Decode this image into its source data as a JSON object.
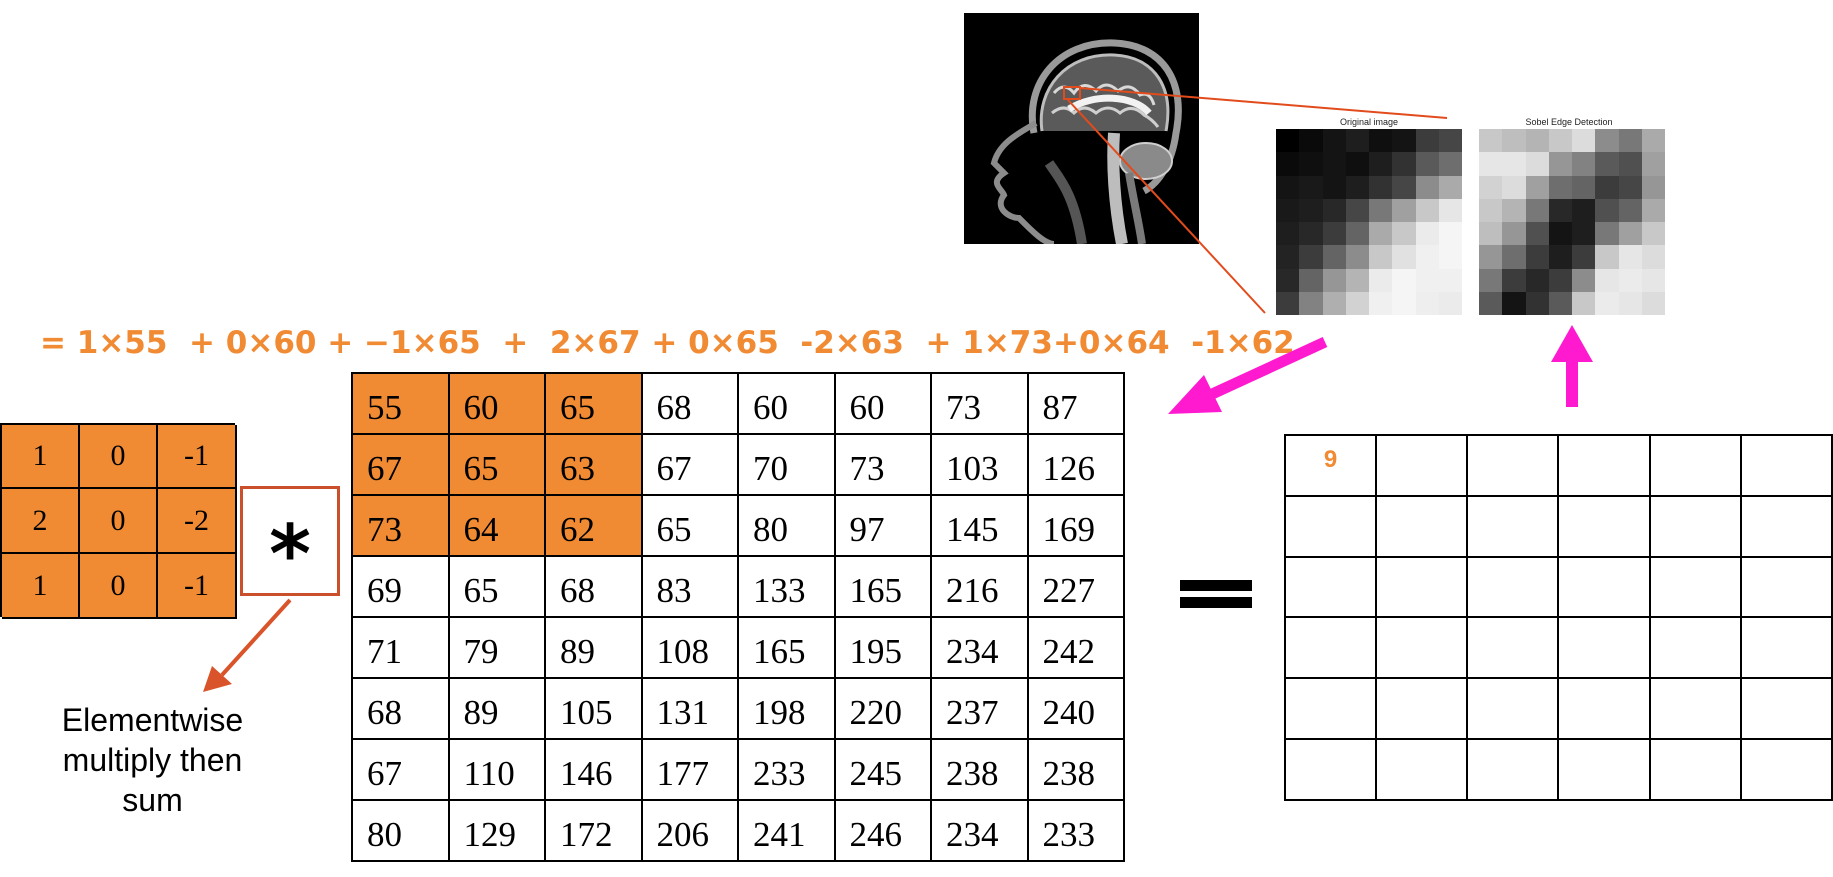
{
  "formula": "= 1×55  + 0×60 + −1×65  +  2×67 + 0×65  -2×63  + 1×73+0×64  -1×62",
  "kernel": {
    "rows": [
      [
        "1",
        "0",
        "-1"
      ],
      [
        "2",
        "0",
        "-2"
      ],
      [
        "1",
        "0",
        "-1"
      ]
    ]
  },
  "operator_symbol": "*",
  "caption_lines": [
    "Elementwise",
    "multiply then",
    "sum"
  ],
  "image_matrix": {
    "rows": [
      [
        "55",
        "60",
        "65",
        "68",
        "60",
        "60",
        "73",
        "87"
      ],
      [
        "67",
        "65",
        "63",
        "67",
        "70",
        "73",
        "103",
        "126"
      ],
      [
        "73",
        "64",
        "62",
        "65",
        "80",
        "97",
        "145",
        "169"
      ],
      [
        "69",
        "65",
        "68",
        "83",
        "133",
        "165",
        "216",
        "227"
      ],
      [
        "71",
        "79",
        "89",
        "108",
        "165",
        "195",
        "234",
        "242"
      ],
      [
        "68",
        "89",
        "105",
        "131",
        "198",
        "220",
        "237",
        "240"
      ],
      [
        "67",
        "110",
        "146",
        "177",
        "233",
        "245",
        "238",
        "238"
      ],
      [
        "80",
        "129",
        "172",
        "206",
        "241",
        "246",
        "234",
        "233"
      ]
    ],
    "highlight_rows": 3,
    "highlight_cols": 3
  },
  "output_matrix": {
    "rows": [
      [
        "9",
        "",
        "",
        "",
        "",
        ""
      ],
      [
        "",
        "",
        "",
        "",
        "",
        ""
      ],
      [
        "",
        "",
        "",
        "",
        "",
        ""
      ],
      [
        "",
        "",
        "",
        "",
        "",
        ""
      ],
      [
        "",
        "",
        "",
        "",
        "",
        ""
      ],
      [
        "",
        "",
        "",
        "",
        "",
        ""
      ]
    ]
  },
  "thumbnails": {
    "original_title": "Original image",
    "sobel_title": "Sobel Edge Detection",
    "original_gray": [
      [
        0,
        10,
        20,
        30,
        15,
        20,
        60,
        70
      ],
      [
        10,
        15,
        20,
        15,
        30,
        50,
        90,
        110
      ],
      [
        20,
        25,
        20,
        30,
        50,
        70,
        140,
        170
      ],
      [
        25,
        30,
        40,
        70,
        120,
        160,
        200,
        230
      ],
      [
        30,
        40,
        60,
        100,
        170,
        200,
        235,
        245
      ],
      [
        35,
        60,
        100,
        140,
        200,
        225,
        240,
        245
      ],
      [
        40,
        100,
        150,
        180,
        235,
        245,
        240,
        240
      ],
      [
        60,
        130,
        175,
        210,
        240,
        245,
        238,
        235
      ]
    ],
    "sobel_gray": [
      [
        200,
        190,
        180,
        200,
        220,
        140,
        120,
        170
      ],
      [
        230,
        230,
        220,
        150,
        130,
        90,
        80,
        160
      ],
      [
        210,
        220,
        160,
        110,
        100,
        60,
        70,
        150
      ],
      [
        200,
        180,
        120,
        40,
        30,
        80,
        100,
        170
      ],
      [
        190,
        150,
        80,
        20,
        30,
        120,
        160,
        200
      ],
      [
        150,
        110,
        60,
        30,
        60,
        200,
        230,
        220
      ],
      [
        120,
        60,
        40,
        60,
        140,
        230,
        235,
        230
      ],
      [
        90,
        20,
        50,
        90,
        200,
        235,
        230,
        220
      ]
    ]
  },
  "colors": {
    "accent_orange": "#f08a33",
    "arrow_magenta": "#ff1ad0",
    "callout_red": "#d9542a"
  }
}
